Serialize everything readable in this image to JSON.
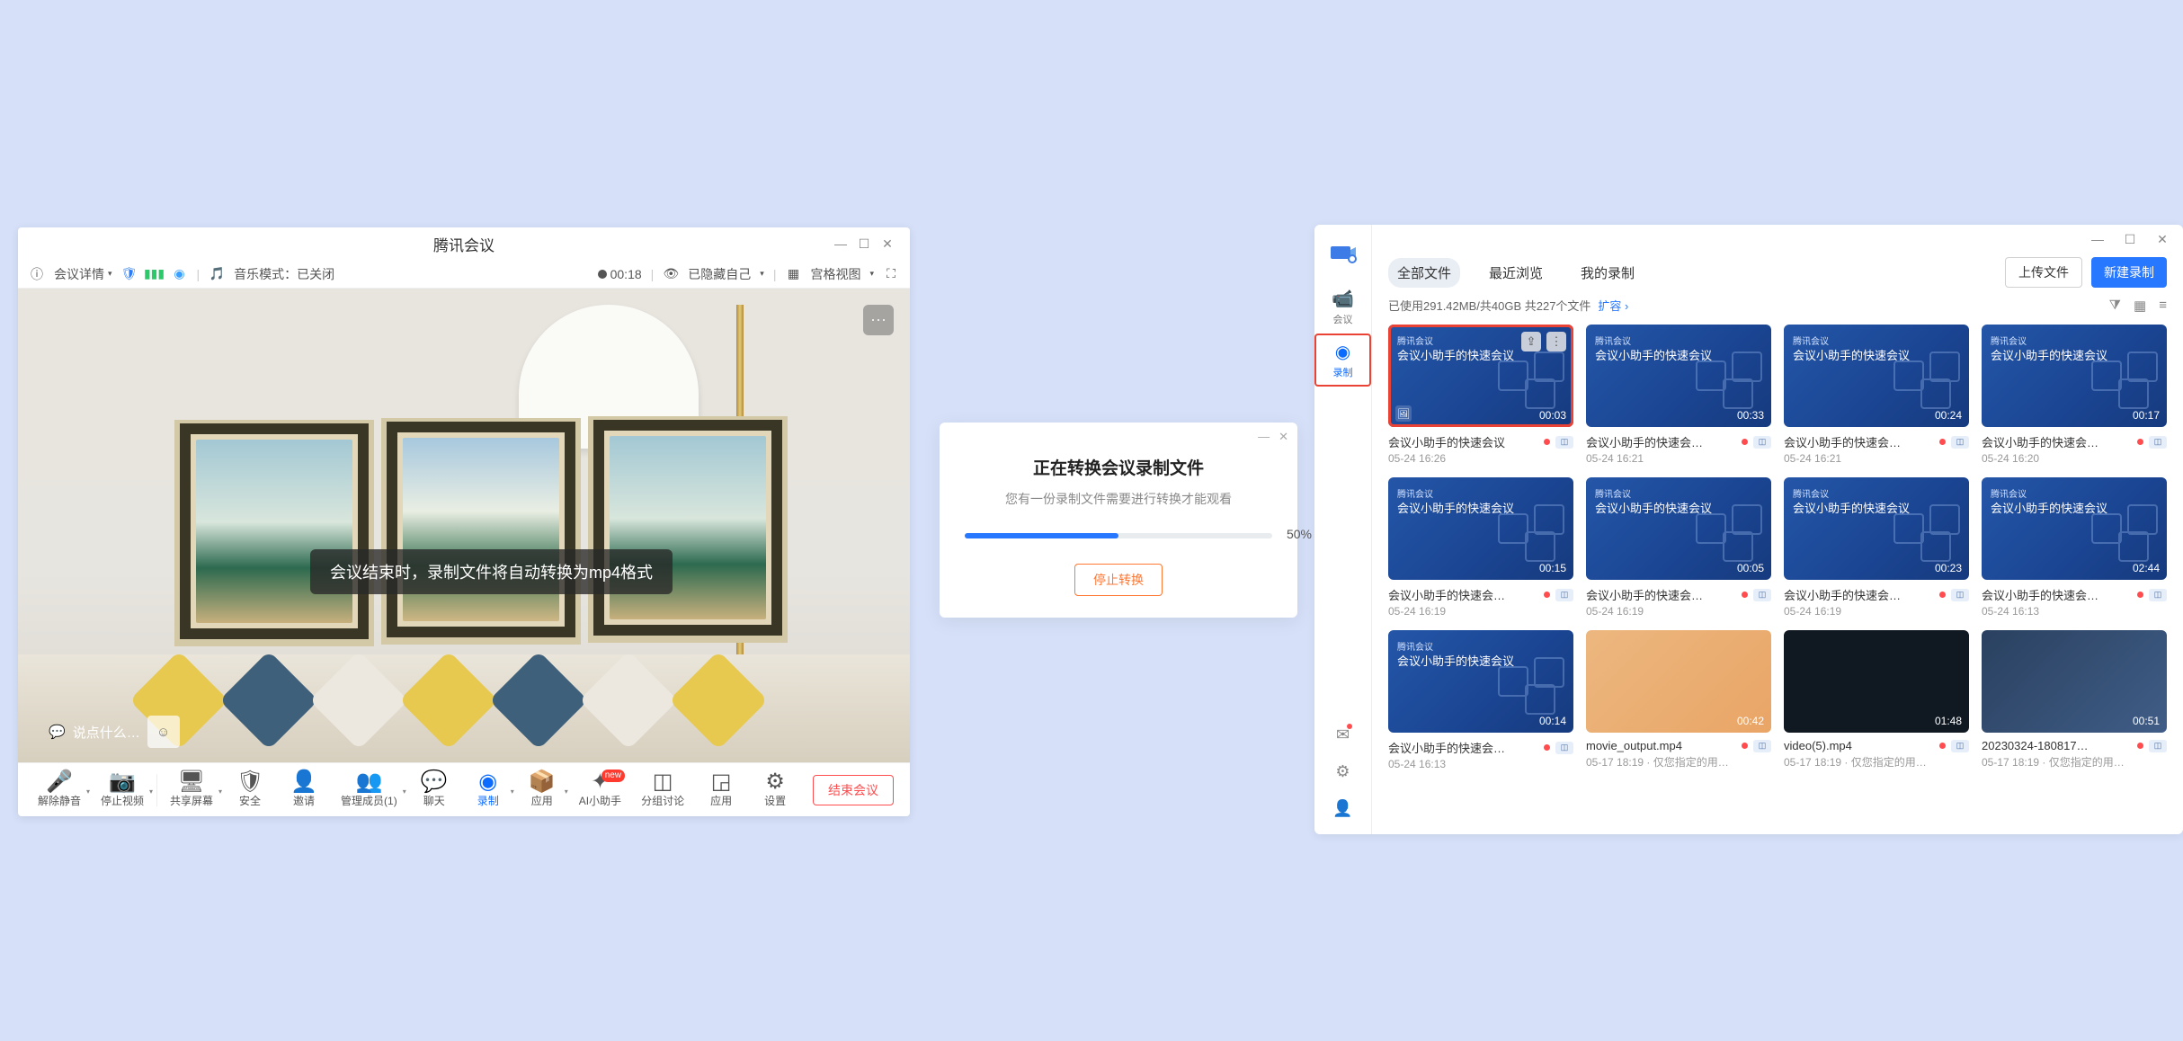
{
  "meeting": {
    "title": "腾讯会议",
    "detailLabel": "会议详情",
    "musicModeLabel": "音乐模式：已关闭",
    "timer": "00:18",
    "hiddenSelf": "已隐藏自己",
    "speakerView": "宫格视图",
    "tooltip": "会议结束时，录制文件将自动转换为mp4格式",
    "chatPlaceholder": "说点什么…",
    "tools": [
      {
        "label": "解除静音"
      },
      {
        "label": "停止视频"
      },
      {
        "label": "共享屏幕"
      },
      {
        "label": "安全"
      },
      {
        "label": "邀请"
      },
      {
        "label": "管理成员(1)"
      },
      {
        "label": "聊天"
      },
      {
        "label": "录制"
      },
      {
        "label": "应用"
      },
      {
        "label": "AI小助手"
      },
      {
        "label": "分组讨论"
      },
      {
        "label": "应用"
      },
      {
        "label": "设置"
      }
    ],
    "endLabel": "结束会议"
  },
  "dialog": {
    "title": "正在转换会议录制文件",
    "subtitle": "您有一份录制文件需要进行转换才能观看",
    "progressPct": "50%",
    "stopLabel": "停止转换"
  },
  "library": {
    "logoLabel": "腾讯会议",
    "side": [
      {
        "label": "会议"
      },
      {
        "label": "录制"
      }
    ],
    "tabs": [
      "全部文件",
      "最近浏览",
      "我的录制"
    ],
    "uploadLabel": "上传文件",
    "newRecLabel": "新建录制",
    "statusText": "已使用291.42MB/共40GB 共227个文件",
    "expandLabel": "扩容",
    "thumbBrand": "腾讯会议",
    "cards": [
      {
        "title": "会议小助手的快速会议",
        "innerTitle": "会议小助手的快速会议",
        "dur": "00:03",
        "sub": "05-24 16:26",
        "hasThumbActions": true,
        "highlight": true,
        "badgeBL": true
      },
      {
        "title": "会议小助手的快速会…",
        "innerTitle": "会议小助手的快速会议",
        "dur": "00:33",
        "sub": "05-24 16:21"
      },
      {
        "title": "会议小助手的快速会…",
        "innerTitle": "会议小助手的快速会议",
        "dur": "00:24",
        "sub": "05-24 16:21"
      },
      {
        "title": "会议小助手的快速会…",
        "innerTitle": "会议小助手的快速会议",
        "dur": "00:17",
        "sub": "05-24 16:20"
      },
      {
        "title": "会议小助手的快速会…",
        "innerTitle": "会议小助手的快速会议",
        "dur": "00:15",
        "sub": "05-24 16:19"
      },
      {
        "title": "会议小助手的快速会…",
        "innerTitle": "会议小助手的快速会议",
        "dur": "00:05",
        "sub": "05-24 16:19"
      },
      {
        "title": "会议小助手的快速会…",
        "innerTitle": "会议小助手的快速会议",
        "dur": "00:23",
        "sub": "05-24 16:19"
      },
      {
        "title": "会议小助手的快速会…",
        "innerTitle": "会议小助手的快速会议",
        "dur": "02:44",
        "sub": "05-24 16:13"
      },
      {
        "title": "会议小助手的快速会…",
        "innerTitle": "会议小助手的快速会议",
        "dur": "00:14",
        "sub": "05-24 16:13"
      },
      {
        "title": "movie_output.mp4",
        "dur": "00:42",
        "sub": "05-17 18:19 · 仅您指定的用…",
        "variant": "img",
        "noInner": true
      },
      {
        "title": "video(5).mp4",
        "dur": "01:48",
        "sub": "05-17 18:19 · 仅您指定的用…",
        "variant": "dark",
        "noInner": true
      },
      {
        "title": "20230324-180817…",
        "dur": "00:51",
        "sub": "05-17 18:19 · 仅您指定的用…",
        "variant": "desk",
        "noInner": true
      }
    ]
  }
}
